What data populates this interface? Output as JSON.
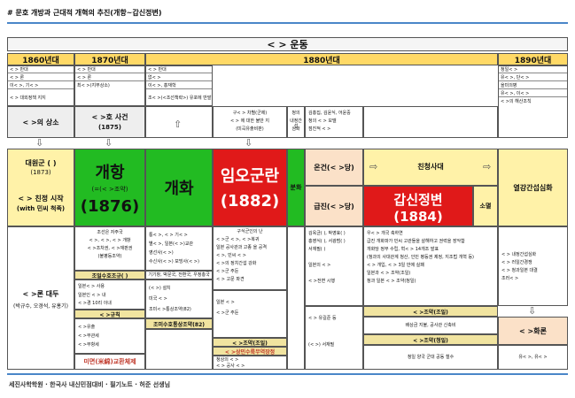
{
  "page_title": "# 문호 개방과 근대적 개혁의 추진(개항~갑신정변)",
  "main_header": "<        > 운동",
  "eras": [
    "1860년대",
    "1870년대",
    "1880년대",
    "1890년대"
  ],
  "col1": {
    "rows": [
      "<          > 반대",
      "<          > 론",
      "이<       >, 기<       >",
      "<     > 대외정책 지지"
    ],
    "sangso": "<     >의 상소",
    "daewongun": "대원군 (     )",
    "daewongun_year": "(1873)",
    "chinjeong": "<     > 친정 시작",
    "chinjeong_sub": "(with 민씨 척족)",
    "bottom_title": "<     >론 대두",
    "bottom_sub": "(박규수, 오경석, 유홍기)"
  },
  "col2": {
    "rows": [
      "<          > 반대",
      "<          > 론",
      "최<       >(지부상소)"
    ],
    "incident": "<     >호 사건",
    "incident_year": "(1875)",
    "gaehang": "개항",
    "treaty": "(=(<     >조약)",
    "treaty_year": "(1876)",
    "notes": [
      "조선은 자주국",
      "<     >, <     >, <     > 개항",
      "<     >조차권, <     >재판권",
      "(불평등조약)"
    ],
    "trade_title": "조일수호조규(    )",
    "trade_rows": [
      "일본<     > 사용",
      "일본인 <     > 내",
      "<     >경 10리 이내"
    ],
    "gyugyu": "<     >규칙",
    "gyugyu_rows": [
      "<     >유출",
      "<     >무관세",
      "<     >무항세"
    ],
    "kyorui": "미면(米綿)교환체제"
  },
  "col3": {
    "rows": [
      "<          > 반대",
      "없<     >",
      "이<     >, 홍재학",
      "조<     >(<조선책략>) 유포에 반발"
    ],
    "gaehwa": "개화",
    "notes": [
      "통<     >, <     > 기<     >",
      "별<     >, 일본(<     >)교관",
      "영선사(<     >)",
      "수신사(<     >) 보빙사(<     >)"
    ],
    "mid_rows": [
      "기기창, 박문국, 전환국, 우정총국"
    ],
    "right_rows": [
      "(<     >) 설치",
      "미국 <     >",
      "조미<     >통상조약(82)"
    ],
    "bottom_row": "조미수호통상조약(82)"
  },
  "col4": {
    "top": [
      "구<     > 차별(군제)",
      "<     > 에 대한 불만 지",
      "(미곡유출비판)"
    ],
    "imo": "임오군란",
    "imo_year": "(1882)",
    "notes": [
      "구식군인의 난",
      "<     >군 <     >, <     >복귀",
      "일본 공사관과 고종 을 공격",
      "<     >, 민씨 <     >",
      "<     >의 정치간섭 강화",
      "<     >군 주둔",
      "<     > 고문 파견"
    ],
    "joyak": "<     >조약(조일)",
    "joyak2": "<     >조약(청)",
    "joyak_rows": [
      "일본 <     >",
      "<     >군 주둔"
    ],
    "sangmin": "<     >상민수륙무역장정",
    "sangmin_rows": [
      "청상의 <     >",
      "<     > 공사 <     >"
    ]
  },
  "col5": {
    "bunhwa": "분화",
    "top": [
      "청의",
      "내정간섭",
      "심화"
    ]
  },
  "col6": {
    "top": [
      "김홍집, 김윤식, 어윤중",
      "청의 <     > 모델",
      "점진적 <     >"
    ],
    "onkeon": "온건(<     >당)",
    "geupjin": "급진(<     >당)",
    "right_top": [
      "<     > 유길준 등",
      "(<     >) 서재필"
    ],
    "notes": [
      "김옥균(    ), 박영효(    )",
      "홍영식(    ), 서광범(    )",
      "서재필(    )",
      "일본의 <     >",
      "<     >전면 시행"
    ]
  },
  "col7": {
    "chinchung": "친청사대",
    "gapsin": "갑신정변",
    "gapsin_year": "(1884)",
    "failure": "소멸",
    "notes": [
      "우<     > 개국 축하연",
      "급진 개화파가 민씨 고관들을 살해하고 권력을 장악함",
      "개화당 정부 수립, 혁<     > 14개조 발표",
      "(청과의 사대관계 청산, 인민 평등권 제정, 지조법 개혁 등)",
      "<     > 개입, <     > 3일 만에 실패",
      "일본과 <     > 조약(조일)",
      "청과 일본 <     > 조약(청일)"
    ],
    "hanseong": "<     >조약(조일)",
    "tianjin": "<     >조약(청일)",
    "bottom_rows": [
      "배상금 지불, 공사관 신축비",
      "청일 양국 군대 공동 철수"
    ]
  },
  "col8": {
    "top_rows": [
      "청일<     >",
      "유<     >, 단<     >",
      "을미의병",
      "유<     >, 이<     >",
      "<     >의 해산조칙"
    ],
    "geoyeon": "열강간섭심화",
    "rows": [
      "<     > 내정간섭심화",
      "<     > 러일간경쟁",
      "<     > 청과일본 대결",
      "조러<     >"
    ],
    "hwaron": "<     >화론",
    "bottom_rows": [
      "유<     >, 유<     >"
    ]
  },
  "footer": "세진사학학원 · 한국사 내신민점대비 · 필기노트 · 허준 선생님"
}
